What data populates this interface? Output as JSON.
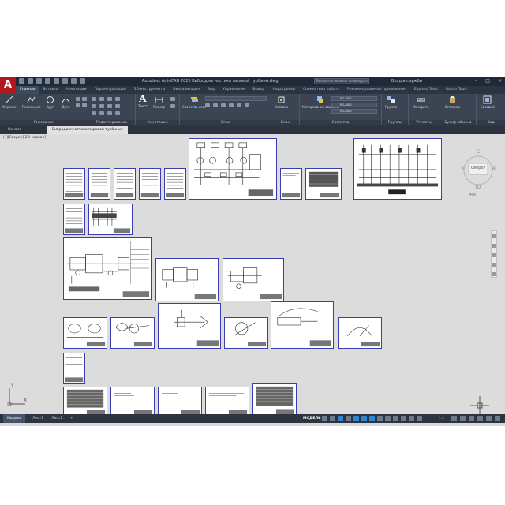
{
  "app": {
    "logo_letter": "A",
    "title": "Autodesk AutoCAD 2020   Вибродиагностика паровой турбины.dwg",
    "search_placeholder": "Введите ключевое слово/фразу",
    "signin": "Вход в службы",
    "window_controls": [
      "–",
      "□",
      "×"
    ]
  },
  "ribbon_tabs": [
    "Главная",
    "Вставка",
    "Аннотации",
    "Параметризация",
    "3D-инструменты",
    "Визуализация",
    "Вид",
    "Управление",
    "Вывод",
    "Надстройки",
    "Совместная работа",
    "Рекомендованные приложения",
    "Express Tools",
    "Raster Tools"
  ],
  "ribbon": {
    "draw": {
      "label": "Рисование",
      "tools": [
        "Отрезок",
        "Полилиния",
        "Круг",
        "Дуга"
      ]
    },
    "modify": {
      "label": "Редактирование"
    },
    "annotation": {
      "label": "Аннотации",
      "tools": [
        "Текст",
        "Размер"
      ]
    },
    "layers": {
      "label": "Слои",
      "tool": "Свойства слоя"
    },
    "block": {
      "label": "Блок",
      "tool": "Вставка"
    },
    "properties": {
      "label": "Свойства",
      "tool": "Копирование свойств",
      "combo1": "ПоСлою",
      "combo2": "ПоСлою",
      "combo3": "ПоСлою"
    },
    "groups": {
      "label": "Группы",
      "tool": "Группа"
    },
    "utilities": {
      "label": "Утилиты",
      "tool": "Измерить"
    },
    "clipboard": {
      "label": "Буфер обмена",
      "tool": "Вставить"
    },
    "view": {
      "label": "Вид",
      "tool": "Базовый"
    }
  },
  "file_tabs": [
    "Начало",
    "Вибродиагностика паровой турбины*"
  ],
  "viewport_label": "[–][Сверху][2D-каркас]",
  "viewcube": {
    "face": "Сверху",
    "north": "С",
    "south": "Ю",
    "west": "З",
    "east": "В",
    "wcs": "МСК"
  },
  "ucs": {
    "x": "X",
    "y": "Y"
  },
  "status": {
    "layout_tabs": [
      "Модель",
      "Лист1",
      "Лист2"
    ],
    "add": "+",
    "model_button": "МОДЕЛЬ",
    "scale": "1:1"
  }
}
